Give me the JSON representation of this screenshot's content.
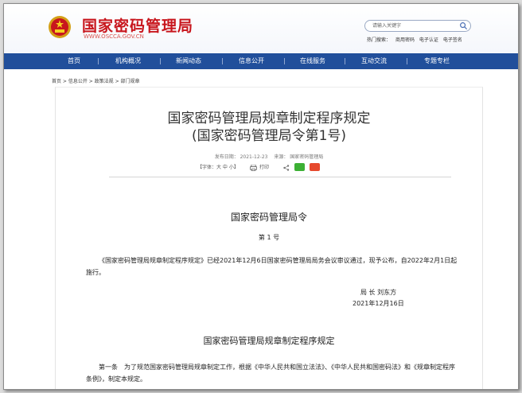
{
  "header": {
    "site_title": "国家密码管理局",
    "site_url": "WWW.OSCCA.GOV.CN",
    "search_placeholder": "请输入关键字",
    "links": [
      "热门搜索：",
      "商用密码",
      "电子认证",
      "电子签名"
    ]
  },
  "nav": {
    "items": [
      "首页",
      "机构概况",
      "新闻动态",
      "信息公开",
      "在线服务",
      "互动交流",
      "专题专栏"
    ]
  },
  "breadcrumb": "首页 > 信息公开 > 政策法规 > 部门规章",
  "article": {
    "title_line1": "国家密码管理局规章制定程序规定",
    "title_line2": "(国家密码管理局令第1号)",
    "publish_date": "发布日期： 2021-12-23",
    "source": "来源： 国家密码管理局",
    "font_size_label": "【字体：大 中 小】",
    "print_label": "打印",
    "decree_heading": "国家密码管理局令",
    "decree_number": "第 1 号",
    "decree_body": "《国家密码管理局规章制定程序规定》已经2021年12月6日国家密码管理局局务会议审议通过，现予公布，自2022年2月1日起施行。",
    "signer": "局 长 刘东方",
    "sign_date": "2021年12月16日",
    "rules_heading": "国家密码管理局规章制定程序规定",
    "article_1": "第一条　为了规范国家密码管理局规章制定工作，根据《中华人民共和国立法法》、《中华人民共和国密码法》和《规章制定程序条例》，制定本规定。"
  },
  "colors": {
    "brand_red": "#c8161d",
    "nav_blue": "#214f9b"
  },
  "icons": [
    "national-emblem-icon",
    "search-icon",
    "print-icon",
    "share-icon",
    "wechat-icon",
    "weibo-icon"
  ]
}
